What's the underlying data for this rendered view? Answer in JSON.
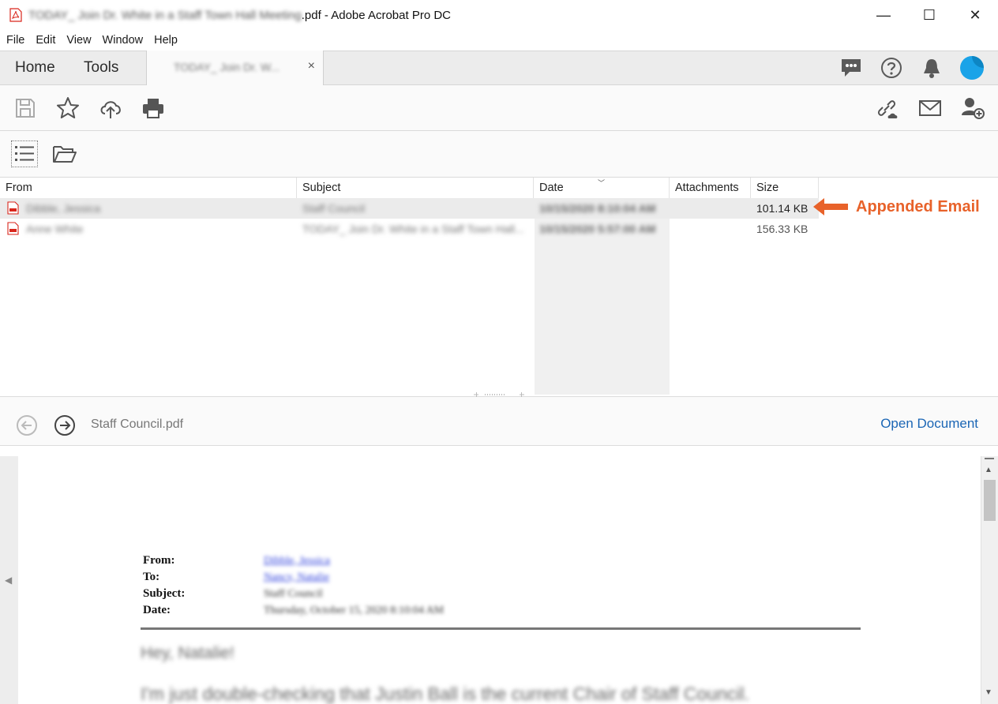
{
  "titlebar": {
    "doc_name": "TODAY_ Join Dr. White in a Staff Town Hall Meeting",
    "suffix": ".pdf - Adobe Acrobat Pro DC",
    "minimize": "—",
    "maximize": "☐",
    "close": "✕"
  },
  "menu": {
    "items": [
      "File",
      "Edit",
      "View",
      "Window",
      "Help"
    ]
  },
  "tabs": {
    "home": "Home",
    "tools": "Tools",
    "doc_tab_label": "TODAY_ Join Dr. W...",
    "doc_tab_close": "×"
  },
  "icons": {
    "tabbar_right": [
      "comment-icon",
      "help-icon",
      "bell-icon",
      "avatar"
    ],
    "toolbar_left": [
      "save-icon",
      "star-icon",
      "cloud-upload-icon",
      "print-icon"
    ],
    "toolbar_right": [
      "share-link-icon",
      "email-icon",
      "add-user-icon"
    ]
  },
  "list": {
    "columns": {
      "from": "From",
      "subject": "Subject",
      "date": "Date",
      "attachments": "Attachments",
      "size": "Size"
    },
    "rows": [
      {
        "from": "Dibble, Jessica",
        "subject": "Staff Council",
        "date": "10/15/2020 8:10:04 AM",
        "size": "101.14 KB",
        "selected": true
      },
      {
        "from": "Anne White",
        "subject": "TODAY_ Join Dr. White in a Staff Town Hall...",
        "date": "10/15/2020 5:57:00 AM",
        "size": "156.33 KB",
        "selected": false
      }
    ]
  },
  "annotation": {
    "label": "Appended Email",
    "color": "#e8622a"
  },
  "navbar": {
    "filename": "Staff Council.pdf",
    "open_document": "Open Document"
  },
  "preview": {
    "labels": {
      "from": "From:",
      "to": "To:",
      "subject": "Subject:",
      "date": "Date:"
    },
    "values": {
      "from": "Dibble, Jessica",
      "to": "Nancy, Natalie",
      "subject": "Staff Council",
      "date": "Thursday, October 15, 2020 8:10:04 AM"
    },
    "greeting": "Hey, Natalie!",
    "body_line": "I'm just double-checking that Justin Ball is the current Chair of Staff Council."
  },
  "colors": {
    "link_blue": "#1b66b5",
    "avatar_blue": "#1aa3e8",
    "pdf_red": "#d9261c"
  }
}
